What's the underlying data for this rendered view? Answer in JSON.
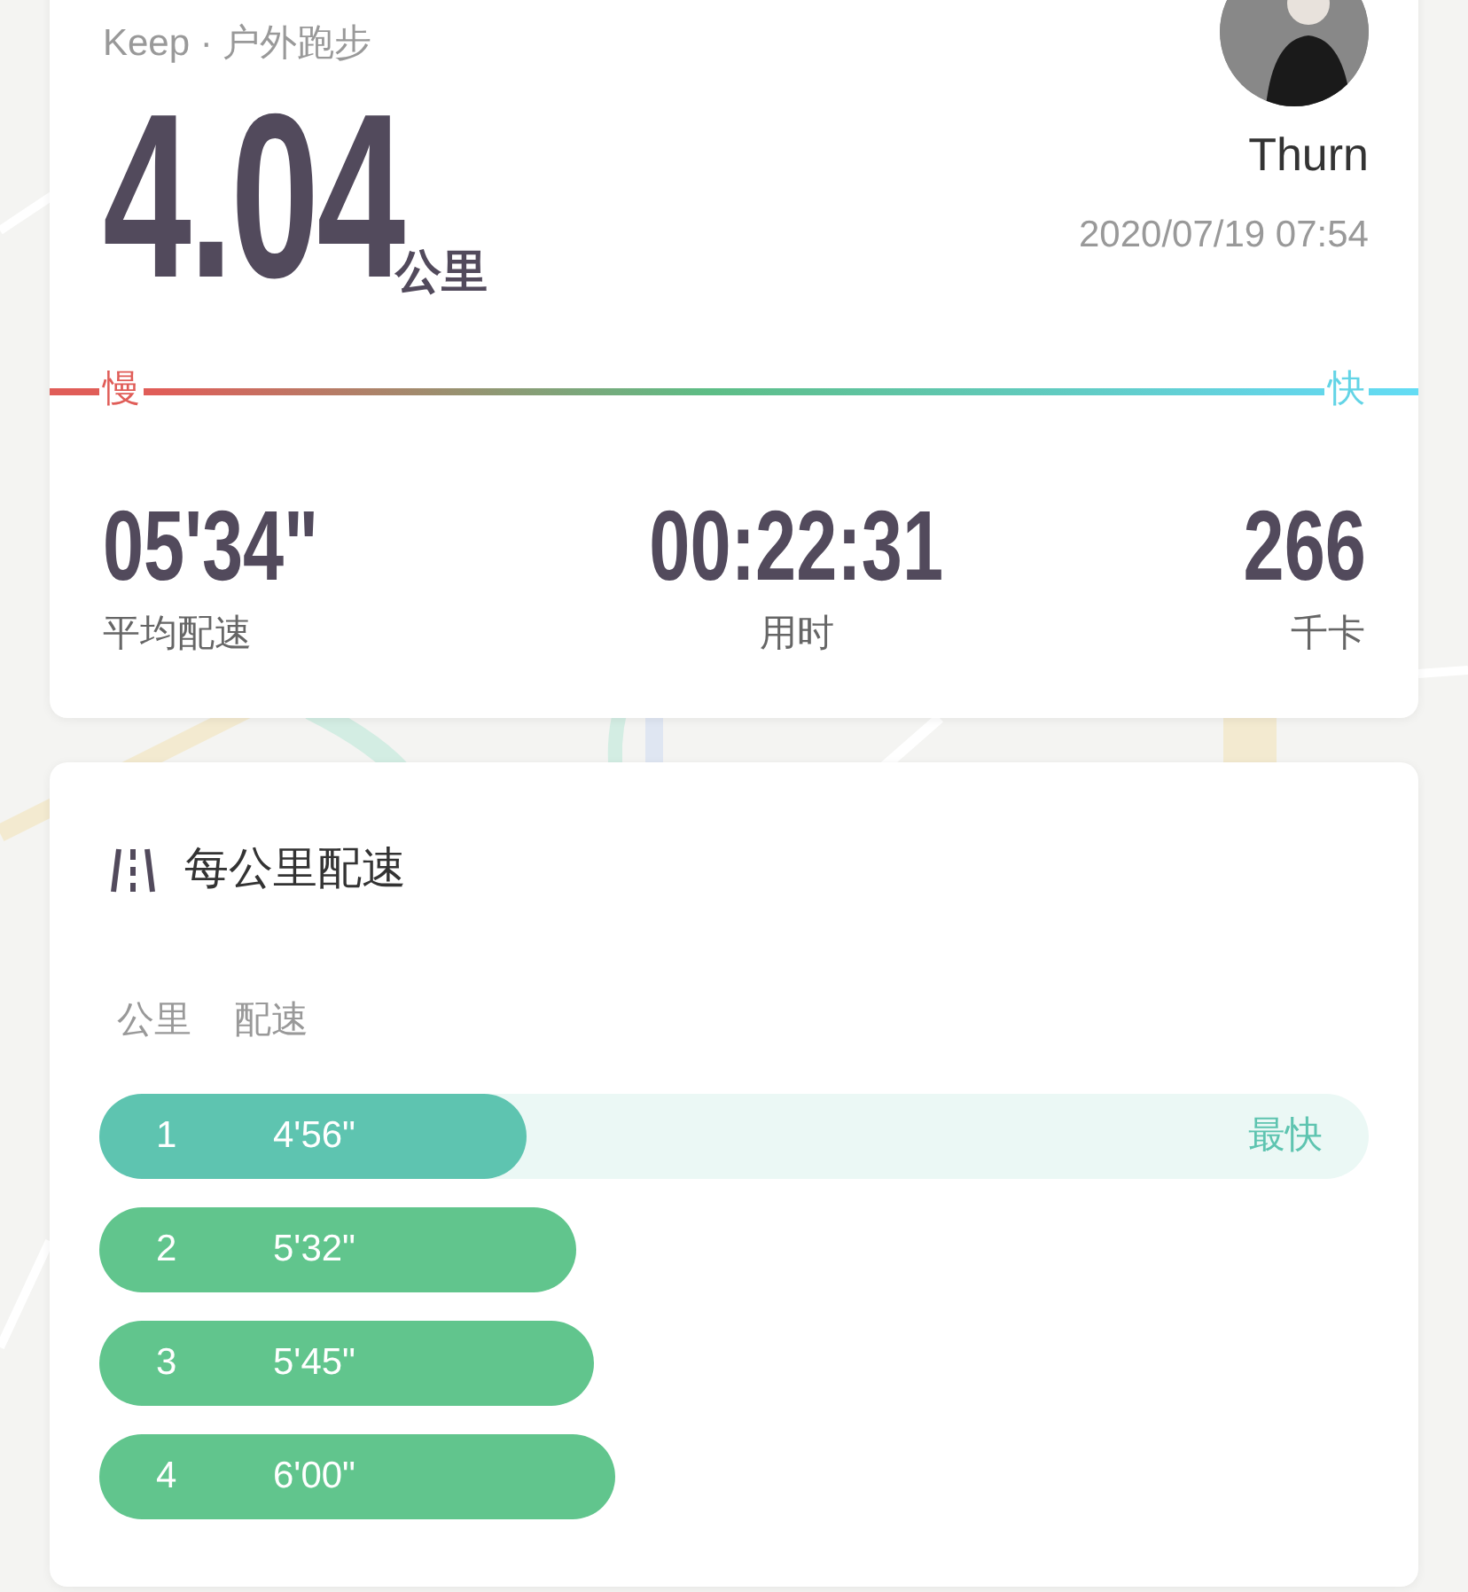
{
  "header": {
    "source": "Keep · 户外跑步",
    "distance": "4.04",
    "distance_unit": "公里",
    "user": "Thurn",
    "datetime": "2020/07/19 07:54"
  },
  "speed_scale": {
    "slow_label": "慢",
    "fast_label": "快"
  },
  "stats": [
    {
      "value": "05'34\"",
      "label": "平均配速"
    },
    {
      "value": "00:22:31",
      "label": "用时"
    },
    {
      "value": "266",
      "label": "千卡"
    }
  ],
  "splits": {
    "title": "每公里配速",
    "columns": [
      "公里",
      "配速"
    ],
    "rows": [
      {
        "km": "1",
        "pace": "4'56\"",
        "level": 0.337,
        "fastest": true,
        "badge": "最快"
      },
      {
        "km": "2",
        "pace": "5'32\"",
        "fastest": false
      },
      {
        "km": "3",
        "pace": "5'45\"",
        "fastest": false
      },
      {
        "km": "4",
        "pace": "6'00\"",
        "fastest": false
      }
    ]
  }
}
